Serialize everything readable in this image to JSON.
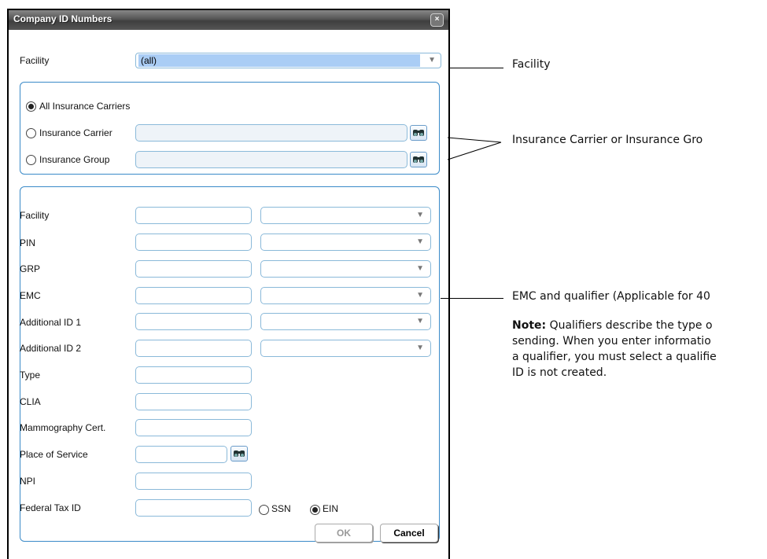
{
  "dialog": {
    "title": "Company ID Numbers",
    "close_glyph": "×",
    "facility_label": "Facility",
    "facility_value": "(all)",
    "carrier_group": {
      "all_label": "All Insurance Carriers",
      "carrier_label": "Insurance Carrier",
      "group_label": "Insurance Group",
      "selected": "All Insurance Carriers"
    },
    "fields": [
      {
        "label": "Facility"
      },
      {
        "label": "PIN"
      },
      {
        "label": "GRP"
      },
      {
        "label": "EMC"
      },
      {
        "label": "Additional ID 1"
      },
      {
        "label": "Additional ID 2"
      },
      {
        "label": "Type"
      },
      {
        "label": "CLIA"
      },
      {
        "label": "Mammography Cert."
      },
      {
        "label": "Place of Service"
      },
      {
        "label": "NPI"
      },
      {
        "label": "Federal Tax ID"
      }
    ],
    "tax_type": {
      "ssn_label": "SSN",
      "ein_label": "EIN",
      "selected": "EIN"
    },
    "ok_label": "OK",
    "cancel_label": "Cancel"
  },
  "callouts": {
    "facility": "Facility",
    "carrier": "Insurance Carrier or Insurance Gro",
    "emc": "EMC and qualifier (Applicable for 40",
    "note_bold": "Note:",
    "note_line1": " Qualifiers describe the type o",
    "note_line2": "sending. When you enter informatio",
    "note_line3": "a qualifier, you must select a qualifie",
    "note_line4": "ID is not created."
  },
  "icons": {
    "lookup": "binoculars-icon",
    "dropdown": "chevron-down-icon",
    "close": "close-icon"
  },
  "colors": {
    "titlebar": "#555555",
    "border_accent": "#3a8ac8",
    "selection": "#aacdf5"
  }
}
